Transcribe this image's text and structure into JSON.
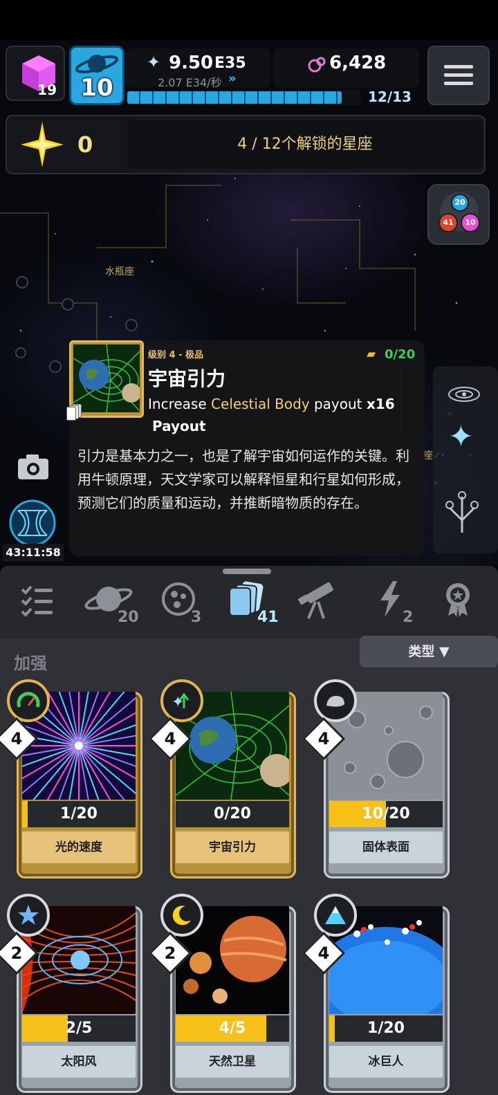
{
  "header": {
    "cube_count": "19",
    "level": "10",
    "energy_value": "9.50",
    "energy_exp": "E35",
    "energy_rate": "2.07 E34/秒",
    "orb_value": "6,428",
    "progress_text": "12/13",
    "progress_fraction": 0.923
  },
  "constellation": {
    "star_count": "0",
    "unlocked_text": "4 / 12个解锁的星座",
    "map_label_aquarius": "水瓶座",
    "map_label_partial": "座✓",
    "timer": "43:11:58",
    "badge_numbers": [
      "20",
      "41",
      "10"
    ]
  },
  "tooltip": {
    "rarity": "级别 4 - 极品",
    "cards_count": "0/20",
    "title": "宇宙引力",
    "effect_prefix": "Increase ",
    "effect_highlight": "Celestial Body",
    "effect_suffix": " payout ",
    "effect_mult": "x16",
    "effect_line2": "Payout",
    "description": "引力是基本力之一，也是了解宇宙如何运作的关键。利用牛顿原理，天文学家可以解释恒星和行星如何形成，预测它们的质量和运动，并推断暗物质的存在。"
  },
  "tabs": [
    {
      "icon": "checklist-icon",
      "count": ""
    },
    {
      "icon": "planet-icon",
      "count": "20"
    },
    {
      "icon": "moon-craters-icon",
      "count": "3"
    },
    {
      "icon": "cards-icon",
      "count": "41"
    },
    {
      "icon": "telescope-icon",
      "count": ""
    },
    {
      "icon": "lightning-icon",
      "count": "2"
    },
    {
      "icon": "medal-icon",
      "count": ""
    }
  ],
  "section": {
    "title": "加强",
    "filter_label": "类型 ▼"
  },
  "cards": [
    {
      "name": "光的速度",
      "level": "4",
      "progress": "1/20",
      "fill": 0.05,
      "tier": "gold",
      "icon": "speedometer-icon"
    },
    {
      "name": "宇宙引力",
      "level": "4",
      "progress": "0/20",
      "fill": 0.0,
      "tier": "gold",
      "icon": "sparkle-up-icon"
    },
    {
      "name": "固体表面",
      "level": "4",
      "progress": "10/20",
      "fill": 0.5,
      "tier": "silver",
      "icon": "rock-icon"
    },
    {
      "name": "太阳风",
      "level": "2",
      "progress": "2/5",
      "fill": 0.4,
      "tier": "silver",
      "icon": "star-icon"
    },
    {
      "name": "天然卫星",
      "level": "2",
      "progress": "4/5",
      "fill": 0.8,
      "tier": "silver",
      "icon": "crescent-moon-icon"
    },
    {
      "name": "冰巨人",
      "level": "4",
      "progress": "1/20",
      "fill": 0.05,
      "tier": "silver",
      "icon": "ice-peak-icon"
    }
  ],
  "colors": {
    "accent_blue": "#2aa7e0",
    "gold": "#e6c27a",
    "highlight_yellow": "#f5c118",
    "progress_green": "#3ecf5a"
  }
}
